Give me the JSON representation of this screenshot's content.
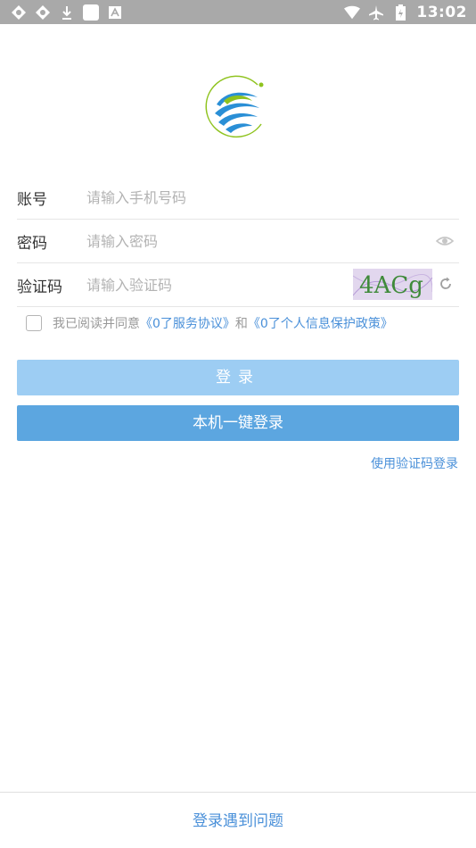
{
  "status_bar": {
    "time": "13:02",
    "left_icons": [
      "sync-icon",
      "sync-icon",
      "download-icon",
      "notification-square-icon",
      "font-a-icon"
    ],
    "right_icons": [
      "wifi-icon",
      "airplane-icon",
      "battery-icon"
    ]
  },
  "logo": {
    "icon": "china-mobile-logo-icon"
  },
  "form": {
    "account": {
      "label": "账号",
      "placeholder": "请输入手机号码"
    },
    "password": {
      "label": "密码",
      "placeholder": "请输入密码",
      "icon": "eye-icon"
    },
    "captcha": {
      "label": "验证码",
      "placeholder": "请输入验证码",
      "image_text": "4ACg",
      "icon": "refresh-icon"
    }
  },
  "agreement": {
    "prefix": "我已阅读并同意",
    "link1": "《0了服务协议》",
    "conj": "和",
    "link2": "《0了个人信息保护政策》"
  },
  "buttons": {
    "login": "登录",
    "onekey": "本机一键登录"
  },
  "sms_login": "使用验证码登录",
  "help": "登录遇到问题",
  "colors": {
    "accent": "#4a90d9",
    "login_disabled": "#9dcdf3",
    "onekey": "#5ca6e0",
    "status_bar": "#a9a9a9"
  }
}
